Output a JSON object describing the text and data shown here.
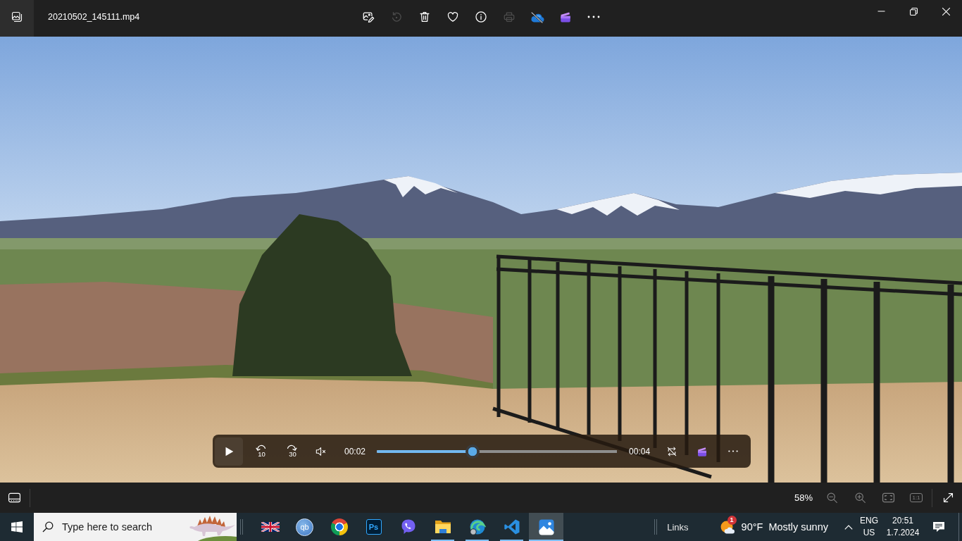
{
  "window": {
    "title": "20210502_145111.mp4"
  },
  "toolbar": [
    {
      "kind": "edit",
      "disabled": false
    },
    {
      "kind": "rotate",
      "disabled": true
    },
    {
      "kind": "delete",
      "disabled": false
    },
    {
      "kind": "favorite",
      "disabled": false
    },
    {
      "kind": "info",
      "disabled": false
    },
    {
      "kind": "print",
      "disabled": true
    },
    {
      "kind": "cloud",
      "disabled": false
    },
    {
      "kind": "editor",
      "disabled": false
    },
    {
      "kind": "more",
      "disabled": false
    }
  ],
  "player": {
    "playing": false,
    "skip_back": "10",
    "skip_forward": "30",
    "muted": true,
    "elapsed": "00:02",
    "level": 0.4,
    "duration": "00:04",
    "repeat": false
  },
  "view_bar": {
    "zoom": "58%",
    "buttons": [
      {
        "kind": "zoom-out",
        "disabled": true
      },
      {
        "kind": "zoom-in",
        "disabled": true
      },
      {
        "kind": "fit",
        "disabled": true
      },
      {
        "kind": "actual-size",
        "label": "1:1",
        "disabled": true
      },
      {
        "kind": "fullscreen",
        "disabled": false
      }
    ]
  },
  "taskbar": {
    "search": {
      "placeholder": "Type here to search"
    },
    "apps": [
      {
        "kind": "flag",
        "running": false,
        "selected": false
      },
      {
        "kind": "round-letters",
        "label": "qb",
        "running": false,
        "selected": false
      },
      {
        "kind": "ring",
        "running": false,
        "selected": false
      },
      {
        "kind": "square-letters",
        "label": "Ps",
        "running": false,
        "selected": false
      },
      {
        "kind": "bubble",
        "running": false,
        "selected": false
      },
      {
        "kind": "folder",
        "running": true,
        "selected": false
      },
      {
        "kind": "wave",
        "running": true,
        "selected": false
      },
      {
        "kind": "ribbon",
        "running": true,
        "selected": false
      },
      {
        "kind": "picture",
        "running": true,
        "selected": true
      }
    ],
    "links": "Links",
    "weather": {
      "alerts": "1",
      "temperature": "90°F",
      "condition": "Mostly sunny"
    },
    "language": {
      "code": "ENG",
      "region": "US"
    },
    "clock": {
      "time": "20:51",
      "date": "1.7.2024"
    }
  }
}
